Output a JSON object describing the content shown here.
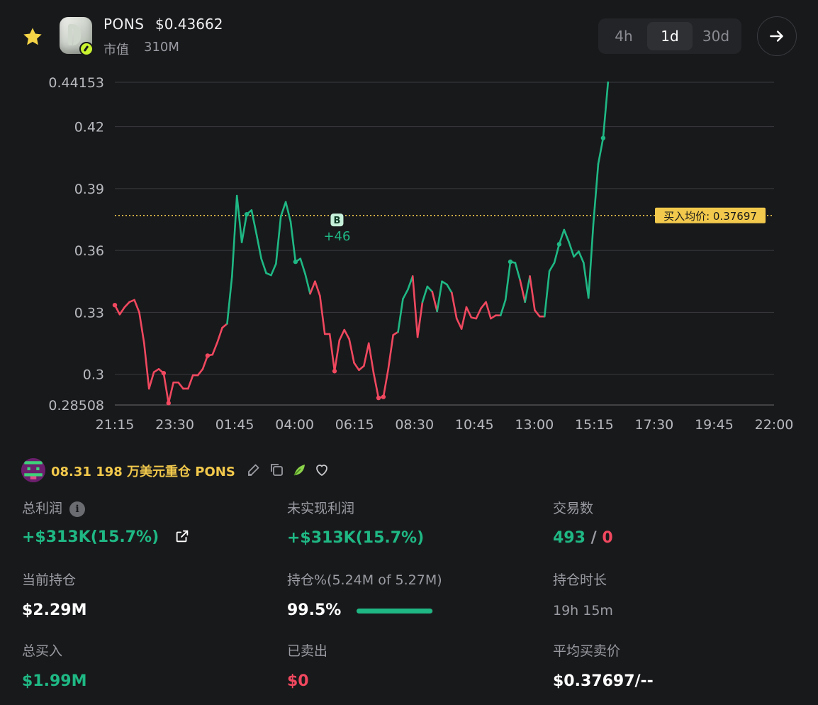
{
  "token": {
    "name": "PONS",
    "price": "$0.43662",
    "mcap_label": "市值",
    "mcap_value": "310M",
    "favorited": true
  },
  "timeframes": [
    {
      "label": "4h",
      "active": false
    },
    {
      "label": "1d",
      "active": true
    },
    {
      "label": "30d",
      "active": false
    }
  ],
  "chart_data": {
    "type": "line",
    "yticks": [
      "0.44153",
      "0.42",
      "0.39",
      "0.36",
      "0.33",
      "0.3",
      "0.28508"
    ],
    "ytick_values": [
      0.44153,
      0.42,
      0.39,
      0.36,
      0.33,
      0.3,
      0.28508
    ],
    "ylim": [
      0.28508,
      0.44153
    ],
    "xticks": [
      "21:15",
      "23:30",
      "01:45",
      "04:00",
      "06:15",
      "08:30",
      "10:45",
      "13:00",
      "15:15",
      "17:30",
      "19:45",
      "22:00"
    ],
    "avg_buy_price": 0.37697,
    "avg_buy_label": "买入均价: 0.37697",
    "marker": {
      "label": "B",
      "annotation": "+46",
      "t": 9.1,
      "y": 0.3765
    },
    "colors": {
      "up": "#1fb884",
      "down": "#f0485f",
      "avg_line": "#f2c94c"
    },
    "series": [
      {
        "t": [
          0.0,
          0.2,
          0.4,
          0.6,
          0.8,
          1.0,
          1.2,
          1.4,
          1.6,
          1.8,
          2.0,
          2.2,
          2.4,
          2.6,
          2.8,
          3.0,
          3.2,
          3.4,
          3.6,
          3.8,
          4.0,
          4.2,
          4.4,
          4.6,
          4.8,
          5.0,
          5.2,
          5.4,
          5.6,
          5.8,
          6.0,
          6.2,
          6.4,
          6.6,
          6.8,
          7.0,
          7.2,
          7.4,
          7.6,
          7.8,
          8.0,
          8.2,
          8.4,
          8.6,
          8.8,
          9.0,
          9.2,
          9.4,
          9.6,
          9.8,
          10.0,
          10.2,
          10.4,
          10.6,
          10.8,
          11.0,
          11.2,
          11.4,
          11.6,
          11.8,
          12.0,
          12.2,
          12.4,
          12.6,
          12.8,
          13.0,
          13.2,
          13.4,
          13.6,
          13.8,
          14.0,
          14.2,
          14.4,
          14.6,
          14.8,
          15.0,
          15.2,
          15.4,
          15.6,
          15.8,
          16.0,
          16.2,
          16.4,
          16.6,
          16.8,
          17.0,
          17.2,
          17.4,
          17.6,
          17.8,
          18.0,
          18.2,
          18.4,
          18.6,
          18.8,
          19.0,
          19.2,
          19.4,
          19.6,
          19.8,
          20.0,
          20.2,
          20.4,
          20.6,
          20.8,
          21.0,
          21.2,
          21.4,
          21.6,
          21.8,
          22.0,
          22.2,
          22.4,
          22.6,
          22.8,
          23.0,
          23.2,
          23.4,
          23.6,
          23.8,
          24.0,
          24.2,
          24.4,
          24.6,
          24.8,
          25.0,
          25.2,
          25.4,
          25.6,
          25.8,
          26.0,
          26.2,
          26.4,
          26.6,
          26.8,
          27.0
        ],
        "y": [
          0.3335,
          0.329,
          0.3325,
          0.335,
          0.336,
          0.33,
          0.315,
          0.293,
          0.301,
          0.3025,
          0.3005,
          0.286,
          0.296,
          0.296,
          0.293,
          0.293,
          0.2995,
          0.2995,
          0.3025,
          0.309,
          0.3095,
          0.3155,
          0.3225,
          0.3245,
          0.3475,
          0.3865,
          0.364,
          0.3775,
          0.3795,
          0.368,
          0.356,
          0.349,
          0.348,
          0.3535,
          0.3765,
          0.3835,
          0.374,
          0.3545,
          0.356,
          0.3485,
          0.339,
          0.345,
          0.338,
          0.3195,
          0.3195,
          0.3015,
          0.3165,
          0.3215,
          0.317,
          0.3055,
          0.302,
          0.304,
          0.315,
          0.3005,
          0.2885,
          0.289,
          0.3025,
          0.319,
          0.3205,
          0.3365,
          0.341,
          0.3475,
          0.318,
          0.335,
          0.3425,
          0.34,
          0.3305,
          0.345,
          0.3435,
          0.3395,
          0.327,
          0.322,
          0.3325,
          0.3275,
          0.327,
          0.332,
          0.335,
          0.327,
          0.3285,
          0.3285,
          0.336,
          0.3545,
          0.354,
          0.3455,
          0.335,
          0.3475,
          0.331,
          0.328,
          0.328,
          0.35,
          0.354,
          0.363,
          0.37,
          0.364,
          0.357,
          0.3595,
          0.354,
          0.337,
          0.373,
          0.402,
          0.4145,
          0.4415
        ]
      }
    ]
  },
  "position_title": "08.31 198 万美元重仓 PONS",
  "stats": {
    "total_profit": {
      "label": "总利润",
      "value": "+$313K(15.7%)"
    },
    "unrealized_profit": {
      "label": "未实现利润",
      "value": "+$313K(15.7%)"
    },
    "trades": {
      "label": "交易数",
      "buys": "493",
      "sep": "/",
      "sells": "0"
    },
    "current_holding": {
      "label": "当前持仓",
      "value": "$2.29M"
    },
    "holding_pct": {
      "label": "持仓%(5.24M of 5.27M)",
      "value": "99.5%",
      "fill": 0.995
    },
    "holding_duration": {
      "label": "持仓时长",
      "value": "19h 15m"
    },
    "total_bought": {
      "label": "总买入",
      "value": "$1.99M"
    },
    "sold": {
      "label": "已卖出",
      "value": "$0"
    },
    "avg_price": {
      "label": "平均买卖价",
      "value": "$0.37697/--"
    }
  }
}
